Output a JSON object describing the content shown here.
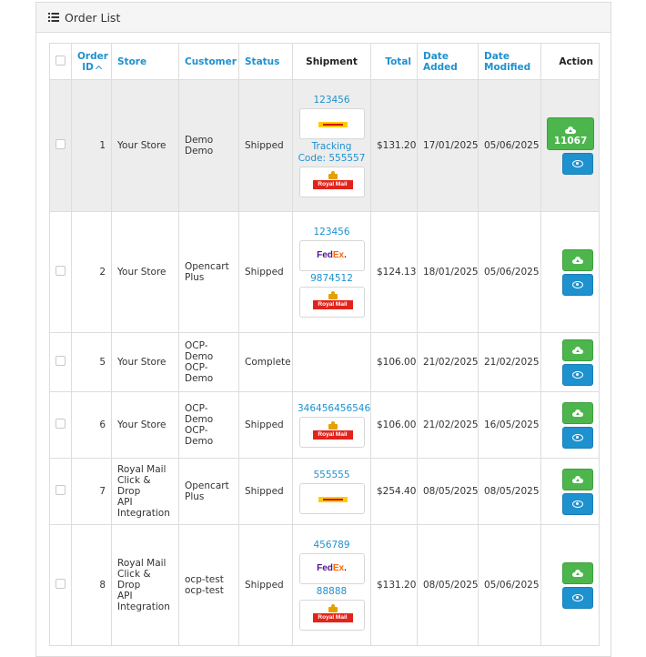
{
  "panel": {
    "title": "Order List"
  },
  "columns": {
    "order_id_line1": "Order",
    "order_id_line2": "ID",
    "store": "Store",
    "customer": "Customer",
    "status": "Status",
    "shipment": "Shipment",
    "total": "Total",
    "date_added_line1": "Date",
    "date_added_line2": "Added",
    "date_modified_line1": "Date",
    "date_modified_line2": "Modified",
    "action": "Action"
  },
  "sort": {
    "column": "order_id",
    "direction": "asc"
  },
  "colors": {
    "link": "#1e91cf",
    "green": "#4cb64c",
    "blue": "#1e91cf",
    "highlight_row": "#ededed"
  },
  "orders": [
    {
      "id": "1",
      "store": "Your Store",
      "customer": [
        "Demo",
        "Demo"
      ],
      "status": "Shipped",
      "shipments": [
        {
          "tracking": "123456",
          "carrier": "DHL",
          "carrier_text": "DHL"
        },
        {
          "tracking": "Tracking Code: 555557",
          "carrier": "Royal Mail",
          "carrier_text": "Royal Mail"
        }
      ],
      "total": "$131.20",
      "date_added": "17/01/2025",
      "date_modified": "05/06/2025",
      "upload_count": "11067",
      "highlighted": true
    },
    {
      "id": "2",
      "store": "Your Store",
      "customer": [
        "Opencart",
        "Plus"
      ],
      "status": "Shipped",
      "shipments": [
        {
          "tracking": "123456",
          "carrier": "FedEx",
          "carrier_text": "FedEx"
        },
        {
          "tracking": "9874512",
          "carrier": "Royal Mail",
          "carrier_text": "Royal Mail"
        }
      ],
      "total": "$124.13",
      "date_added": "18/01/2025",
      "date_modified": "05/06/2025"
    },
    {
      "id": "5",
      "store": "Your Store",
      "customer": [
        "OCP-Demo",
        "OCP-Demo"
      ],
      "status": "Complete",
      "shipments": [],
      "total": "$106.00",
      "date_added": "21/02/2025",
      "date_modified": "21/02/2025"
    },
    {
      "id": "6",
      "store": "Your Store",
      "customer": [
        "OCP-Demo",
        "OCP-Demo"
      ],
      "status": "Shipped",
      "shipments": [
        {
          "tracking": "346456456546",
          "carrier": "Royal Mail",
          "carrier_text": "Royal Mail"
        }
      ],
      "total": "$106.00",
      "date_added": "21/02/2025",
      "date_modified": "16/05/2025"
    },
    {
      "id": "7",
      "store": [
        "Royal Mail",
        "Click & Drop",
        "API",
        "Integration"
      ],
      "customer": [
        "Opencart",
        "Plus"
      ],
      "status": "Shipped",
      "shipments": [
        {
          "tracking": "555555",
          "carrier": "DHL",
          "carrier_text": "DHL"
        }
      ],
      "total": "$254.40",
      "date_added": "08/05/2025",
      "date_modified": "08/05/2025"
    },
    {
      "id": "8",
      "store": [
        "Royal Mail",
        "Click & Drop",
        "API",
        "Integration"
      ],
      "customer": [
        "ocp-test",
        "ocp-test"
      ],
      "status": "Shipped",
      "shipments": [
        {
          "tracking": "456789",
          "carrier": "FedEx",
          "carrier_text": "FedEx"
        },
        {
          "tracking": "88888",
          "carrier": "Royal Mail",
          "carrier_text": "Royal Mail"
        }
      ],
      "total": "$131.20",
      "date_added": "08/05/2025",
      "date_modified": "05/06/2025"
    }
  ]
}
